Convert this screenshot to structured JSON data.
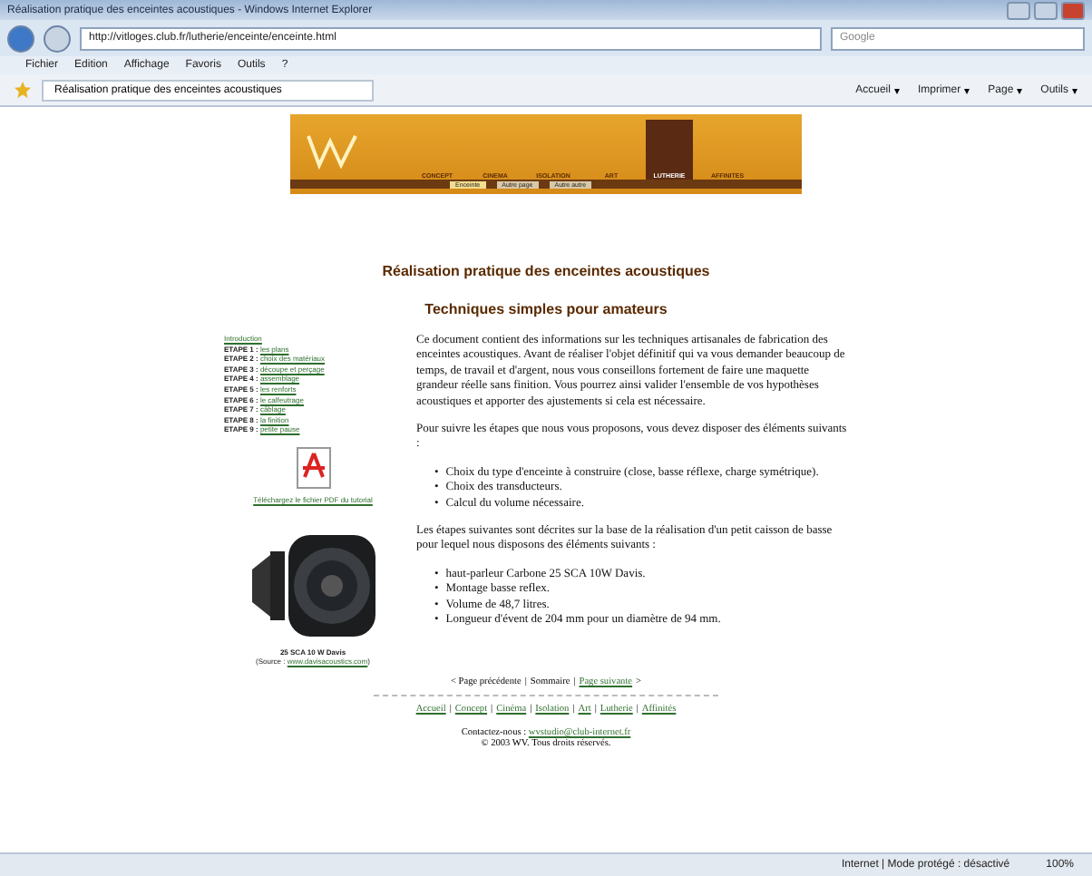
{
  "window": {
    "title": "Réalisation pratique des enceintes acoustiques - Windows Internet Explorer"
  },
  "address_bar": {
    "url": "http://vitloges.club.fr/lutherie/enceinte/enceinte.html",
    "search_placeholder": "Google"
  },
  "menu": [
    "Fichier",
    "Edition",
    "Affichage",
    "Favoris",
    "Outils",
    "?"
  ],
  "tab": {
    "label": "Réalisation pratique des enceintes acoustiques"
  },
  "toolbar": [
    {
      "label": "Accueil",
      "caret": "▾"
    },
    {
      "label": "Imprimer",
      "caret": "▾"
    },
    {
      "label": "Page",
      "caret": "▾"
    },
    {
      "label": "Outils",
      "caret": "▾"
    }
  ],
  "banner": {
    "sections": [
      {
        "label": "CONCEPT",
        "selected": false
      },
      {
        "label": "CINEMA",
        "selected": false
      },
      {
        "label": "ISOLATION",
        "selected": false
      },
      {
        "label": "ART",
        "selected": false
      },
      {
        "label": "LUTHERIE",
        "selected": true
      },
      {
        "label": "AFFINITES",
        "selected": false
      }
    ],
    "subsections": [
      {
        "label": "Enceinte",
        "selected": true
      },
      {
        "label": "Autre page",
        "selected": false
      },
      {
        "label": "Autre autre",
        "selected": false
      }
    ]
  },
  "heading": "Réalisation pratique des enceintes acoustiques",
  "subheading": "Techniques simples pour amateurs",
  "steps": [
    {
      "link": "Introduction"
    },
    {
      "step": "ETAPE 1 :",
      "link": "les plans"
    },
    {
      "step": "ETAPE 2 :",
      "link": "choix des matériaux"
    },
    {
      "step": "ETAPE 3 :",
      "link": "découpe et perçage"
    },
    {
      "step": "ETAPE 4 :",
      "link": "assemblage"
    },
    {
      "step": "ETAPE 5 :",
      "link": "les renforts"
    },
    {
      "step": "ETAPE 6 :",
      "link": "le calfeutrage"
    },
    {
      "step": "ETAPE 7 :",
      "link": "câblage"
    },
    {
      "step": "ETAPE 8 :",
      "link": "la finition"
    },
    {
      "step": "ETAPE 9 :",
      "link": "petite pause"
    }
  ],
  "pdf_link": "Téléchargez le fichier PDF du tutorial",
  "speaker_caption": "25 SCA 10 W Davis",
  "speaker_source": {
    "label": "(Source :",
    "link": "www.davisacoustics.com",
    "end": ")"
  },
  "paragraphs": [
    "Ce document contient des informations sur les techniques artisanales de fabrication des enceintes acoustiques. Avant de réaliser l'objet définitif qui va vous demander beaucoup de temps, de travail et d'argent, nous vous conseillons fortement de faire une maquette grandeur réelle sans finition. Vous pourrez ainsi valider l'ensemble de vos hypothèses acoustiques et apporter des ajustements si cela est nécessaire.",
    "Pour suivre les étapes que nous vous proposons, vous devez disposer des éléments suivants :"
  ],
  "list_1": [
    {
      "bullet": "•",
      "text": "Choix du type d'enceinte à construire (close, basse réflexe, charge symétrique)."
    },
    {
      "bullet": "•",
      "text": "Choix des transducteurs."
    },
    {
      "bullet": "•",
      "text": "Calcul du volume nécessaire."
    }
  ],
  "paragraph_3": "Les étapes suivantes sont décrites sur la base de la réalisation d'un petit caisson de basse pour lequel nous disposons des éléments suivants :",
  "list_2": [
    {
      "bullet": "•",
      "text": "haut-parleur Carbone 25 SCA 10W Davis."
    },
    {
      "bullet": "•",
      "text": "Montage basse reflex."
    },
    {
      "bullet": "•",
      "text": "Volume de 48,7 litres."
    },
    {
      "bullet": "•",
      "text": "Longueur d'évent de 204 mm pour un diamètre de 94 mm."
    }
  ],
  "pager": [
    {
      "kind": "text",
      "text": "< Page précédente"
    },
    {
      "kind": "separator",
      "text": "|"
    },
    {
      "kind": "text",
      "text": "Sommaire"
    },
    {
      "kind": "separator",
      "text": "|"
    },
    {
      "kind": "link",
      "text": "Page suivante"
    },
    {
      "kind": "text",
      "text": ">"
    }
  ],
  "footer_links": [
    {
      "kind": "link",
      "text": "Accueil"
    },
    {
      "kind": "separator",
      "text": "|"
    },
    {
      "kind": "link",
      "text": "Concept"
    },
    {
      "kind": "separator",
      "text": "|"
    },
    {
      "kind": "link",
      "text": "Cinéma"
    },
    {
      "kind": "separator",
      "text": "|"
    },
    {
      "kind": "link",
      "text": "Isolation"
    },
    {
      "kind": "separator",
      "text": "|"
    },
    {
      "kind": "link",
      "text": "Art"
    },
    {
      "kind": "separator",
      "text": "|"
    },
    {
      "kind": "link",
      "text": "Lutherie"
    },
    {
      "kind": "separator",
      "text": "|"
    },
    {
      "kind": "link",
      "text": "Affinités"
    }
  ],
  "contact": {
    "label": "Contactez-nous :",
    "email": "wvstudio@club-internet.fr"
  },
  "copyright": "© 2003 WV. Tous droits réservés.",
  "status_bar": {
    "zone": "Internet | Mode protégé : désactivé",
    "zoom": "100%"
  }
}
